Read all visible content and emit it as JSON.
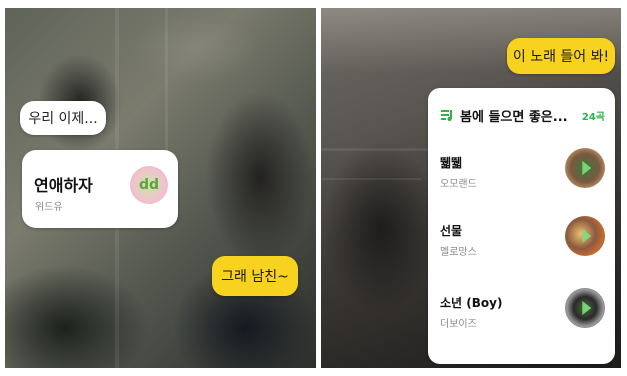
{
  "left_panel": {
    "message": "우리 이제...",
    "song_card": {
      "title": "연애하자",
      "artist": "위드유",
      "cover_text": "dd"
    },
    "reply": "그래 남친~"
  },
  "right_panel": {
    "ask": "이 노래 들어 봐!",
    "playlist": {
      "icon": "playlist-icon",
      "title": "봄에 들으면 좋은...",
      "count": "24곡",
      "tracks": [
        {
          "title": "뛟뛟",
          "artist": "오모랜드"
        },
        {
          "title": "선물",
          "artist": "멜로망스"
        },
        {
          "title": "소년 (Boy)",
          "artist": "더보이즈"
        }
      ]
    }
  },
  "colors": {
    "bubble_yellow": "#f7d21e",
    "accent_green": "#2fb24a",
    "card_white": "#ffffff"
  }
}
